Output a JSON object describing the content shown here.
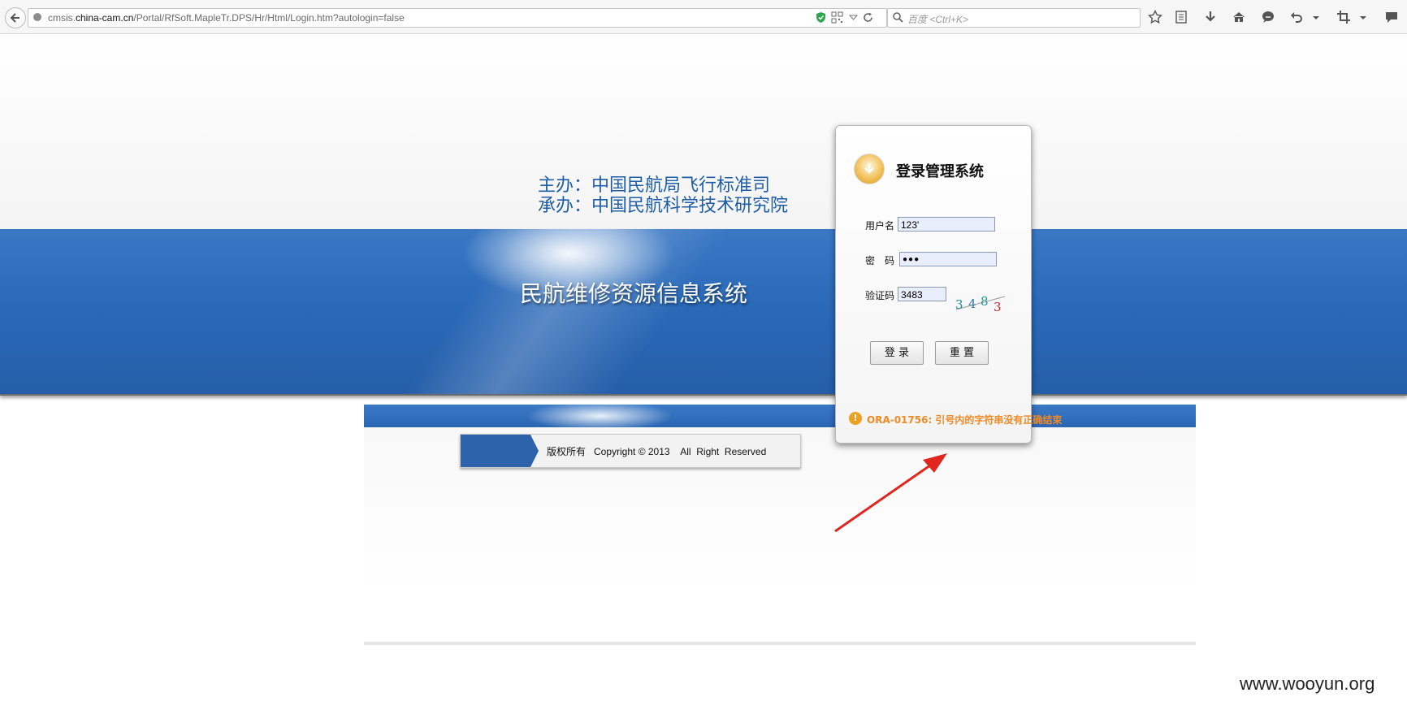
{
  "browser": {
    "url_host_prefix": "cmsis.",
    "url_domain": "china-cam.cn",
    "url_path": "/Portal/RfSoft.MapleTr.DPS/Hr/Html/Login.htm?autologin=false",
    "search_placeholder": "百度 <Ctrl+K>",
    "icons": [
      "back-arrow-icon",
      "globe-icon",
      "shield-icon",
      "qr-icon",
      "dropdown-icon",
      "reload-icon",
      "search-icon",
      "star-icon",
      "reader-icon",
      "download-icon",
      "home-icon",
      "chat-icon",
      "undo-icon",
      "crop-icon",
      "speech-icon"
    ]
  },
  "header": {
    "sponsor_line1": "主办：中国民航局飞行标准司",
    "sponsor_line2": "承办：中国民航科学技术研究院",
    "system_title": "民航维修资源信息系统"
  },
  "footer": {
    "copyright": "版权所有   Copyright © 2013    All  Right  Reserved"
  },
  "login": {
    "title": "登录管理系统",
    "username_label": "用户名",
    "username_value": "123'",
    "password_label": "密　码",
    "password_value": "●●●",
    "captcha_label": "验证码",
    "captcha_value": "3483",
    "captcha_image_text": "3483",
    "login_button": "登 录",
    "reset_button": "重 置",
    "error_message": "ORA-01756: 引号内的字符串没有正确结束"
  },
  "watermark": "www.wooyun.org",
  "colors": {
    "banner_blue": "#2b6ab9",
    "sponsor_text": "#1f5ea6",
    "error_orange": "#f08a24",
    "annotation_red": "#e0261f"
  }
}
